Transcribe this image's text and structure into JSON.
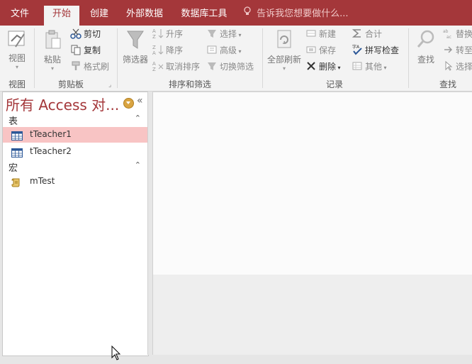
{
  "tabs": [
    "文件",
    "开始",
    "创建",
    "外部数据",
    "数据库工具"
  ],
  "active_tab": "开始",
  "tell_me": "告诉我您想要做什么...",
  "ribbon": {
    "views": {
      "view_label": "视图",
      "group": "视图"
    },
    "clipboard": {
      "paste_label": "粘贴",
      "cut": "剪切",
      "copy": "复制",
      "format_painter": "格式刷",
      "group": "剪贴板"
    },
    "sort_filter": {
      "filter": "筛选器",
      "ascending": "升序",
      "descending": "降序",
      "remove_sort": "取消排序",
      "selection": "选择",
      "advanced": "高级",
      "toggle_filter": "切换筛选",
      "group": "排序和筛选"
    },
    "records": {
      "refresh_all": "全部刷新",
      "new": "新建",
      "save": "保存",
      "delete": "删除",
      "totals": "合计",
      "spelling": "拼写检查",
      "more": "其他",
      "group": "记录"
    },
    "find": {
      "find": "查找",
      "replace": "替换",
      "goto": "转至",
      "select": "选择",
      "group": "查找"
    }
  },
  "nav": {
    "title": "所有 Access 对...",
    "groups": [
      {
        "label": "表",
        "items": [
          "tTeacher1",
          "tTeacher2"
        ]
      },
      {
        "label": "宏",
        "items": [
          "mTest"
        ]
      }
    ],
    "selected_item": "tTeacher1"
  },
  "icons": {
    "table": "table-icon",
    "macro": "macro-scroll-icon",
    "cursor": "mouse-pointer-icon"
  },
  "colors": {
    "accent": "#a4373a",
    "selection": "#f8c4c4"
  }
}
